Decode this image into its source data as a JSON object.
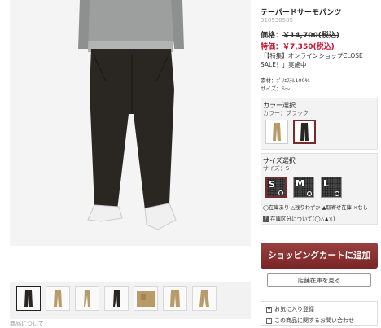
{
  "product": {
    "title": "テーパードサーモパンツ",
    "code": "310530505",
    "original_price_label": "価格：",
    "original_price": "￥14,700(税込)",
    "sale_price": "特価：￥7,350(税込)",
    "campaign_text": "「【特集】オンラインショップCLOSE SALE！」実施中",
    "material": "素材：ﾎﾟﾘｴｽﾃﾙ100%",
    "size_range": "サイズ：S～L"
  },
  "color_select": {
    "label": "カラー選択",
    "current": "カラー：ブラック",
    "options": [
      "beige-pants-swatch",
      "black-pants-swatch"
    ],
    "selected_index": 1
  },
  "size_select": {
    "label": "サイズ選択",
    "current": "サイズ：S",
    "options": [
      "S",
      "M",
      "L"
    ],
    "selected": "S",
    "legend": "◯在庫あり △残りわずか ▲取寄せ在庫 ×なし",
    "inventory_link": "在庫区分について(◯△▲×)"
  },
  "actions": {
    "add_to_cart": "ショッピングカートに追加",
    "store_stock": "店舗在庫を見る",
    "favorite": "お気に入り登録",
    "inquiry": "この商品に関するお問い合わせ"
  },
  "thumbnails": [
    "black-front",
    "beige-front",
    "beige-side",
    "black-side",
    "beige-detail",
    "beige-back",
    "beige-angle"
  ],
  "footer_link": "商品について",
  "colors": {
    "accent": "#7a2626",
    "sale": "#c8102e",
    "pants_black": "#2a2723",
    "pants_beige": "#b89b68"
  }
}
